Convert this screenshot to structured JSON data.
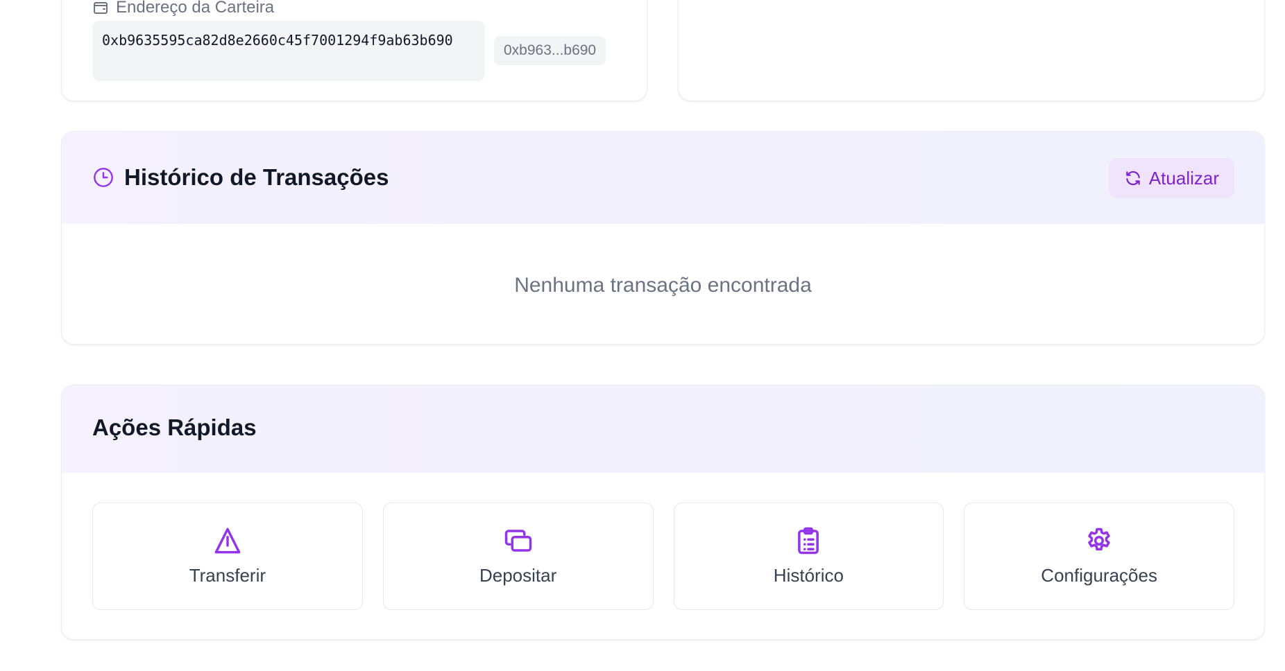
{
  "wallet": {
    "address_label": "Endereço da Carteira",
    "address_full": "0xb9635595ca82d8e2660c45f7001294f9ab63b690",
    "address_short": "0xb963...b690"
  },
  "transactions": {
    "title": "Histórico de Transações",
    "refresh_label": "Atualizar",
    "empty_message": "Nenhuma transação encontrada"
  },
  "quick_actions": {
    "title": "Ações Rápidas",
    "items": [
      {
        "label": "Transferir",
        "icon": "send-icon"
      },
      {
        "label": "Depositar",
        "icon": "cards-icon"
      },
      {
        "label": "Histórico",
        "icon": "clipboard-icon"
      },
      {
        "label": "Configurações",
        "icon": "gear-icon"
      }
    ]
  },
  "colors": {
    "accent": "#7e22ce",
    "icon_purple": "#9333ea",
    "header_tint": "#f5f1fe",
    "muted_text": "#6b7280"
  }
}
